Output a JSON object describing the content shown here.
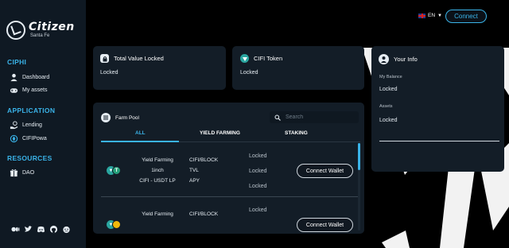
{
  "brand": {
    "name": "Citizen",
    "sub": "Santa Fe"
  },
  "header": {
    "language": "EN",
    "connect_label": "Connect"
  },
  "sidebar": {
    "sections": [
      {
        "title": "CIPHI",
        "items": [
          {
            "label": "Dashboard",
            "icon": "person-icon"
          },
          {
            "label": "My assets",
            "icon": "gamepad-icon"
          }
        ]
      },
      {
        "title": "APPLICATION",
        "items": [
          {
            "label": "Lending",
            "icon": "hand-coin-icon"
          },
          {
            "label": "CIFIPowa",
            "icon": "powa-icon"
          }
        ]
      },
      {
        "title": "RESOURCES",
        "items": [
          {
            "label": "DAO",
            "icon": "gift-icon"
          }
        ]
      }
    ],
    "socials": [
      "medium-icon",
      "twitter-icon",
      "discord-icon",
      "github-icon",
      "reddit-icon"
    ]
  },
  "cards": {
    "tvl": {
      "title": "Total Value Locked",
      "value": "Locked"
    },
    "cifi": {
      "title": "CIFI Token",
      "value": "Locked"
    },
    "info": {
      "title": "Your Info",
      "balance_label": "My Balance",
      "balance_value": "Locked",
      "assets_label": "Assets",
      "assets_value": "Locked"
    }
  },
  "farm": {
    "title": "Farm Pool",
    "search_placeholder": "Search",
    "tabs": [
      "ALL",
      "YIELD FARMING",
      "STAKING"
    ],
    "active_tab": "ALL",
    "rows": [
      {
        "type": "Yield Farming",
        "pair_name": "1inch",
        "lp": "CIFI - USDT LP",
        "stat_labels": [
          "CIFI/BLOCK",
          "TVL",
          "APY"
        ],
        "stat_values": [
          "Locked",
          "Locked",
          "Locked"
        ],
        "button": "Connect Wallet"
      },
      {
        "type": "Yield Farming",
        "pair_name": "",
        "lp": "",
        "stat_labels": [
          "CIFI/BLOCK"
        ],
        "stat_values": [
          "Locked"
        ],
        "button": "Connect Wallet"
      }
    ]
  },
  "colors": {
    "accent": "#3ab3e8",
    "sidebar_bg": "#0f1923",
    "card_bg": "#131d27",
    "background": "#000000"
  }
}
